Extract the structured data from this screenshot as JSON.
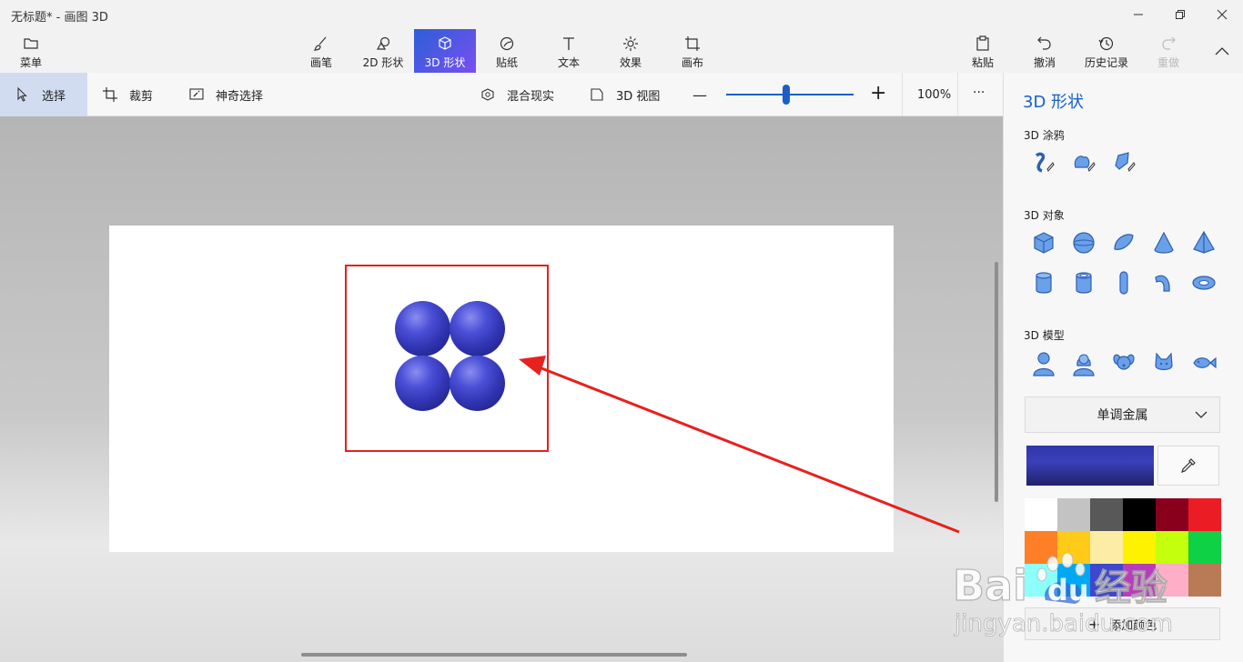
{
  "window": {
    "title": "无标题* - 画图 3D"
  },
  "toolbar": {
    "menu": "菜单",
    "items": [
      {
        "label": "画笔",
        "icon": "brush-icon"
      },
      {
        "label": "2D 形状",
        "icon": "shapes-2d-icon"
      },
      {
        "label": "3D 形状",
        "icon": "cube-icon",
        "active": true
      },
      {
        "label": "贴纸",
        "icon": "sticker-icon"
      },
      {
        "label": "文本",
        "icon": "text-icon"
      },
      {
        "label": "效果",
        "icon": "effects-icon"
      },
      {
        "label": "画布",
        "icon": "canvas-icon"
      }
    ],
    "paste": "粘贴",
    "undo": "撤消",
    "history": "历史记录",
    "redo": "重做"
  },
  "subbar": {
    "select": "选择",
    "crop": "裁剪",
    "magic_select": "神奇选择",
    "mixed_reality": "混合现实",
    "view_3d": "3D 视图",
    "zoom_out": "—",
    "zoom_in": "+",
    "zoom_level": "100%",
    "zoom_fraction": 0.47,
    "more": "···"
  },
  "panel": {
    "title": "3D 形状",
    "doodle_label": "3D 涂鸦",
    "objects_label": "3D 对象",
    "models_label": "3D 模型",
    "material": "单调金属",
    "selected_color": "#2e36a8",
    "palette": [
      "#ffffff",
      "#c3c3c3",
      "#585858",
      "#000000",
      "#88001b",
      "#ec1c24",
      "#ff7f27",
      "#ffca18",
      "#fdeca6",
      "#fff200",
      "#c4ff0e",
      "#0ed145",
      "#8cfffb",
      "#00a8f3",
      "#3f48cc",
      "#b83dba",
      "#ffaec8",
      "#b97a56"
    ],
    "add_color": "添加颜色"
  },
  "watermark": {
    "text_a": "Bai",
    "text_b": "du",
    "text_c": "经验",
    "url": "jingyan.baidu.com"
  }
}
